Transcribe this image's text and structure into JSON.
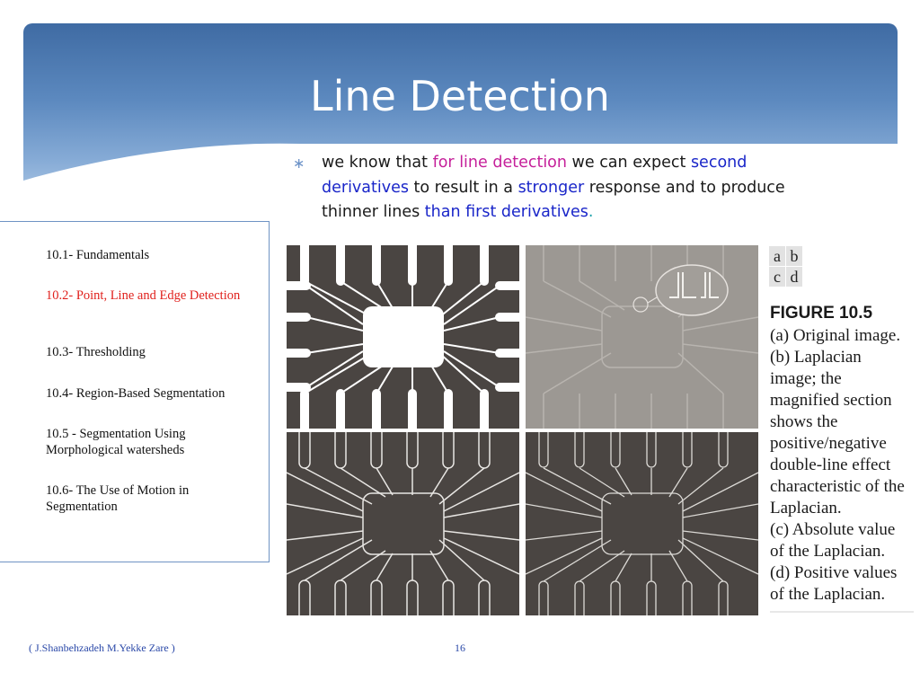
{
  "slide": {
    "title": "Line Detection",
    "bullet": {
      "mark": "∗",
      "t1": " we know that ",
      "t2": "for line detection",
      "t3": " we can expect ",
      "t4": "second derivatives",
      "t5": " to result in a ",
      "t6": "stronger",
      "t7": " response and to produce thinner lines ",
      "t8": "than first derivatives",
      "t9": "."
    }
  },
  "toc": {
    "items": [
      {
        "label": "10.1- Fundamentals"
      },
      {
        "label": "10.2- Point, Line and Edge Detection"
      },
      {
        "label": "10.3- Thresholding"
      },
      {
        "label": "10.4- Region-Based Segmentation"
      },
      {
        "label": "10.5 - Segmentation Using Morphological watersheds"
      },
      {
        "label": "10.6- The Use of Motion in Segmentation"
      }
    ]
  },
  "figure": {
    "labels": [
      "a",
      "b",
      "c",
      "d"
    ],
    "title": "FIGURE 10.5",
    "caption_lines": [
      "(a) Original image.",
      "(b) Laplacian",
      "image; the",
      "magnified section",
      "shows the",
      "positive/negative",
      "double-line effect",
      "characteristic of the",
      "Laplacian.",
      "(c) Absolute value",
      "of the Laplacian.",
      "(d) Positive values",
      "of the Laplacian."
    ]
  },
  "footer": {
    "authors": "( J.Shanbehzadeh   M.Yekke Zare )",
    "page": "16"
  },
  "colors": {
    "accent_magenta": "#c51f9a",
    "accent_blue": "#1a26c9",
    "active_toc": "#e0201c",
    "header_blue": "#4a78b2"
  }
}
